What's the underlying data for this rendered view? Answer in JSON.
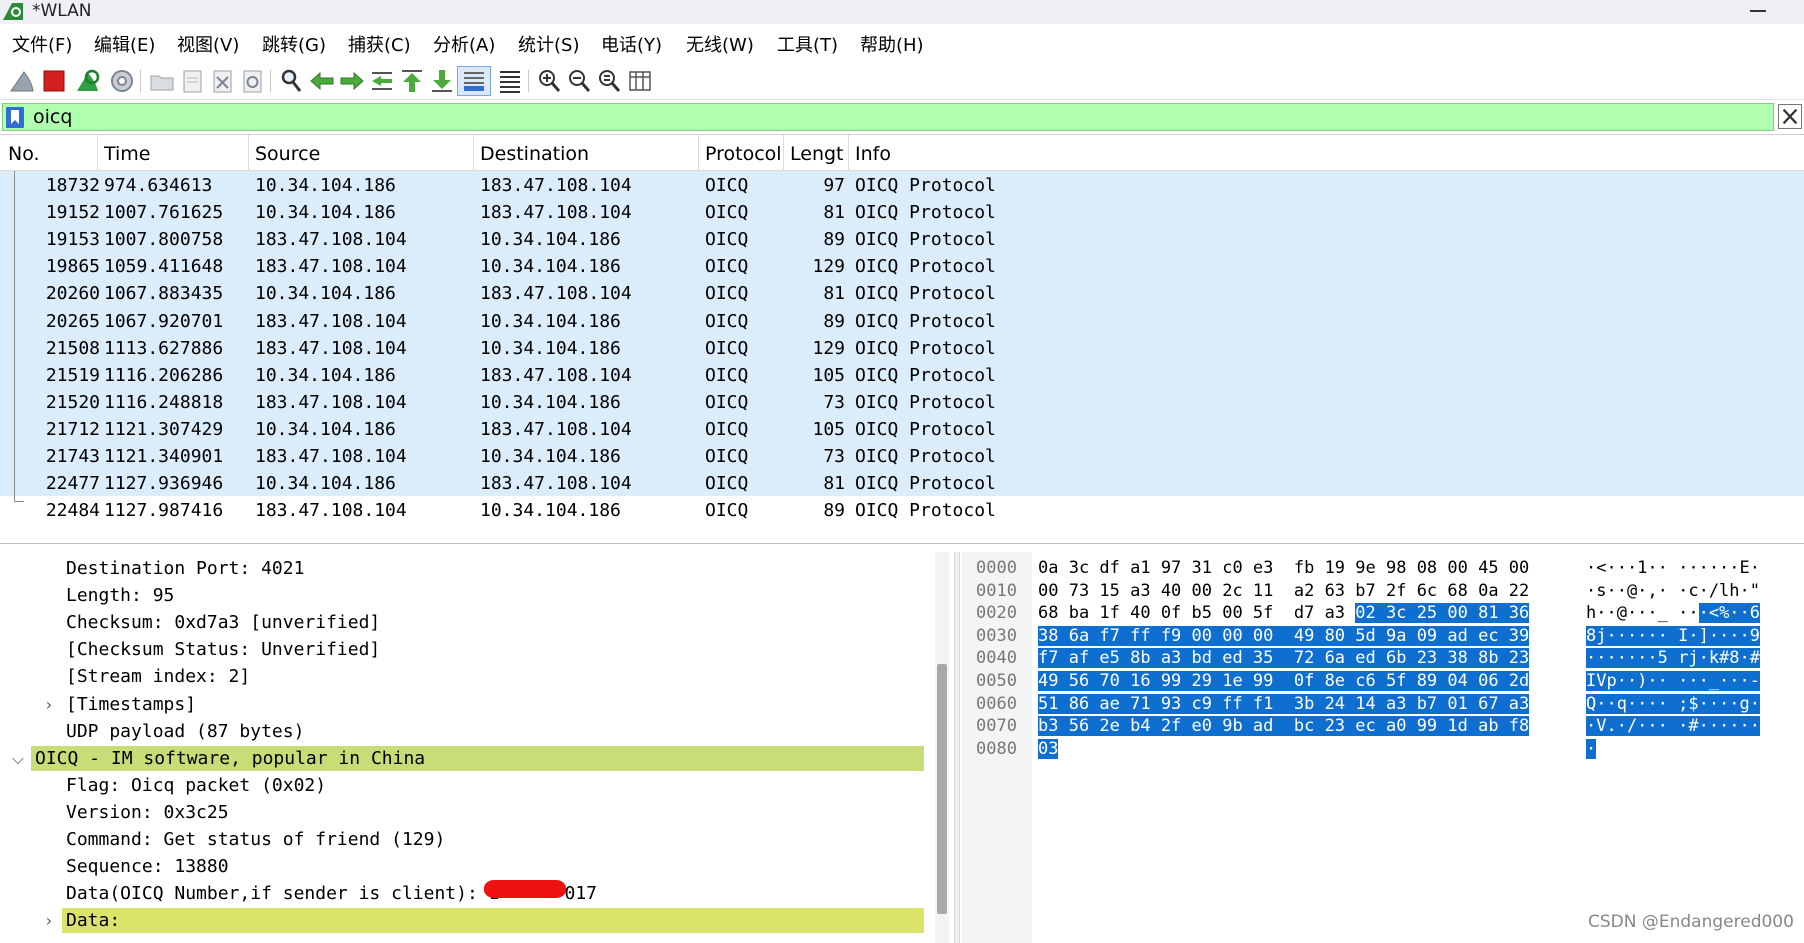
{
  "window": {
    "title": "*WLAN"
  },
  "menu": [
    "文件(F)",
    "编辑(E)",
    "视图(V)",
    "跳转(G)",
    "捕获(C)",
    "分析(A)",
    "统计(S)",
    "电话(Y)",
    "无线(W)",
    "工具(T)",
    "帮助(H)"
  ],
  "filter": {
    "value": "oicq"
  },
  "packet_list": {
    "columns": [
      "No.",
      "Time",
      "Source",
      "Destination",
      "Protocol",
      "Lengtl",
      "Info"
    ],
    "rows": [
      {
        "no": "18732",
        "time": "974.634613",
        "src": "10.34.104.186",
        "dst": "183.47.108.104",
        "proto": "OICQ",
        "len": "97",
        "info": "OICQ Protocol"
      },
      {
        "no": "19152",
        "time": "1007.761625",
        "src": "10.34.104.186",
        "dst": "183.47.108.104",
        "proto": "OICQ",
        "len": "81",
        "info": "OICQ Protocol"
      },
      {
        "no": "19153",
        "time": "1007.800758",
        "src": "183.47.108.104",
        "dst": "10.34.104.186",
        "proto": "OICQ",
        "len": "89",
        "info": "OICQ Protocol"
      },
      {
        "no": "19865",
        "time": "1059.411648",
        "src": "183.47.108.104",
        "dst": "10.34.104.186",
        "proto": "OICQ",
        "len": "129",
        "info": "OICQ Protocol"
      },
      {
        "no": "20260",
        "time": "1067.883435",
        "src": "10.34.104.186",
        "dst": "183.47.108.104",
        "proto": "OICQ",
        "len": "81",
        "info": "OICQ Protocol"
      },
      {
        "no": "20265",
        "time": "1067.920701",
        "src": "183.47.108.104",
        "dst": "10.34.104.186",
        "proto": "OICQ",
        "len": "89",
        "info": "OICQ Protocol"
      },
      {
        "no": "21508",
        "time": "1113.627886",
        "src": "183.47.108.104",
        "dst": "10.34.104.186",
        "proto": "OICQ",
        "len": "129",
        "info": "OICQ Protocol"
      },
      {
        "no": "21519",
        "time": "1116.206286",
        "src": "10.34.104.186",
        "dst": "183.47.108.104",
        "proto": "OICQ",
        "len": "105",
        "info": "OICQ Protocol"
      },
      {
        "no": "21520",
        "time": "1116.248818",
        "src": "183.47.108.104",
        "dst": "10.34.104.186",
        "proto": "OICQ",
        "len": "73",
        "info": "OICQ Protocol"
      },
      {
        "no": "21712",
        "time": "1121.307429",
        "src": "10.34.104.186",
        "dst": "183.47.108.104",
        "proto": "OICQ",
        "len": "105",
        "info": "OICQ Protocol"
      },
      {
        "no": "21743",
        "time": "1121.340901",
        "src": "183.47.108.104",
        "dst": "10.34.104.186",
        "proto": "OICQ",
        "len": "73",
        "info": "OICQ Protocol"
      },
      {
        "no": "22477",
        "time": "1127.936946",
        "src": "10.34.104.186",
        "dst": "183.47.108.104",
        "proto": "OICQ",
        "len": "81",
        "info": "OICQ Protocol"
      },
      {
        "no": "22484",
        "time": "1127.987416",
        "src": "183.47.108.104",
        "dst": "10.34.104.186",
        "proto": "OICQ",
        "len": "89",
        "info": "OICQ Protocol"
      }
    ]
  },
  "details": [
    {
      "text": "Destination Port: 4021",
      "indent": 1,
      "expander": "",
      "highlight": ""
    },
    {
      "text": "Length: 95",
      "indent": 1,
      "expander": "",
      "highlight": ""
    },
    {
      "text": "Checksum: 0xd7a3 [unverified]",
      "indent": 1,
      "expander": "",
      "highlight": ""
    },
    {
      "text": "[Checksum Status: Unverified]",
      "indent": 1,
      "expander": "",
      "highlight": ""
    },
    {
      "text": "[Stream index: 2]",
      "indent": 1,
      "expander": "",
      "highlight": ""
    },
    {
      "text": "[Timestamps]",
      "indent": 1,
      "expander": "collapsed",
      "highlight": ""
    },
    {
      "text": "UDP payload (87 bytes)",
      "indent": 1,
      "expander": "",
      "highlight": ""
    },
    {
      "text": "OICQ - IM software, popular in China",
      "indent": 0,
      "expander": "expanded",
      "highlight": "#c8dc78"
    },
    {
      "text": "Flag: Oicq packet (0x02)",
      "indent": 1,
      "expander": "",
      "highlight": ""
    },
    {
      "text": "Version: 0x3c25",
      "indent": 1,
      "expander": "",
      "highlight": ""
    },
    {
      "text": "Command: Get status of friend (129)",
      "indent": 1,
      "expander": "",
      "highlight": ""
    },
    {
      "text": "Sequence: 13880",
      "indent": 1,
      "expander": "",
      "highlight": ""
    },
    {
      "text": "Data(OICQ Number,if sender is client): 1      017",
      "indent": 1,
      "expander": "",
      "highlight": ""
    },
    {
      "text": "Data:",
      "indent": 1,
      "expander": "collapsed",
      "highlight": "#dce36a"
    }
  ],
  "bytes": [
    {
      "offset": "0000",
      "hex_a": "0a 3c df a1 97 31 c0 e3  fb 19 9e 98 08 00 45 00",
      "hex_b": "",
      "asc_a": "·<···1·· ······E·",
      "asc_b": ""
    },
    {
      "offset": "0010",
      "hex_a": "00 73 15 a3 40 00 2c 11  a2 63 b7 2f 6c 68 0a 22",
      "hex_b": "",
      "asc_a": "·s··@·,· ·c·/lh·\"",
      "asc_b": ""
    },
    {
      "offset": "0020",
      "hex_a": "68 ba 1f 40 0f b5 00 5f  d7 a3 ",
      "hex_b": "02 3c 25 00 81 36",
      "asc_a": "h··@···_ ··",
      "asc_b": "·<%··6"
    },
    {
      "offset": "0030",
      "hex_a": "",
      "hex_b": "38 6a f7 ff f9 00 00 00  49 80 5d 9a 09 ad ec 39",
      "asc_a": "",
      "asc_b": "8j······ I·]····9"
    },
    {
      "offset": "0040",
      "hex_a": "",
      "hex_b": "f7 af e5 8b a3 bd ed 35  72 6a ed 6b 23 38 8b 23",
      "asc_a": "",
      "asc_b": "·······5 rj·k#8·#"
    },
    {
      "offset": "0050",
      "hex_a": "",
      "hex_b": "49 56 70 16 99 29 1e 99  0f 8e c6 5f 89 04 06 2d",
      "asc_a": "",
      "asc_b": "IVp··)·· ···_···-"
    },
    {
      "offset": "0060",
      "hex_a": "",
      "hex_b": "51 86 ae 71 93 c9 ff f1  3b 24 14 a3 b7 01 67 a3",
      "asc_a": "",
      "asc_b": "Q··q···· ;$····g·"
    },
    {
      "offset": "0070",
      "hex_a": "",
      "hex_b": "b3 56 2e b4 2f e0 9b ad  bc 23 ec a0 99 1d ab f8",
      "asc_a": "",
      "asc_b": "·V.·/··· ·#······"
    },
    {
      "offset": "0080",
      "hex_a": "",
      "hex_b": "03",
      "asc_a": "",
      "asc_b": "·"
    }
  ],
  "watermark": "CSDN @Endangered000",
  "colors": {
    "filter_bg": "#afffaf",
    "row_bg": "#dbedfa",
    "oicq_highlight": "#c8dc78",
    "data_highlight": "#dce36a",
    "byte_selection": "#0f6fd1"
  },
  "icons": [
    "shark-fin-icon",
    "stop-capture-icon",
    "restart-capture-icon",
    "capture-options-icon",
    "open-file-icon",
    "save-file-icon",
    "close-file-icon",
    "reload-file-icon",
    "find-packet-icon",
    "go-back-icon",
    "go-forward-icon",
    "go-to-packet-icon",
    "go-first-icon",
    "go-last-icon",
    "auto-scroll-icon",
    "colorize-icon",
    "zoom-in-icon",
    "zoom-out-icon",
    "zoom-reset-icon",
    "resize-columns-icon",
    "bookmark-icon",
    "clear-filter-icon"
  ]
}
